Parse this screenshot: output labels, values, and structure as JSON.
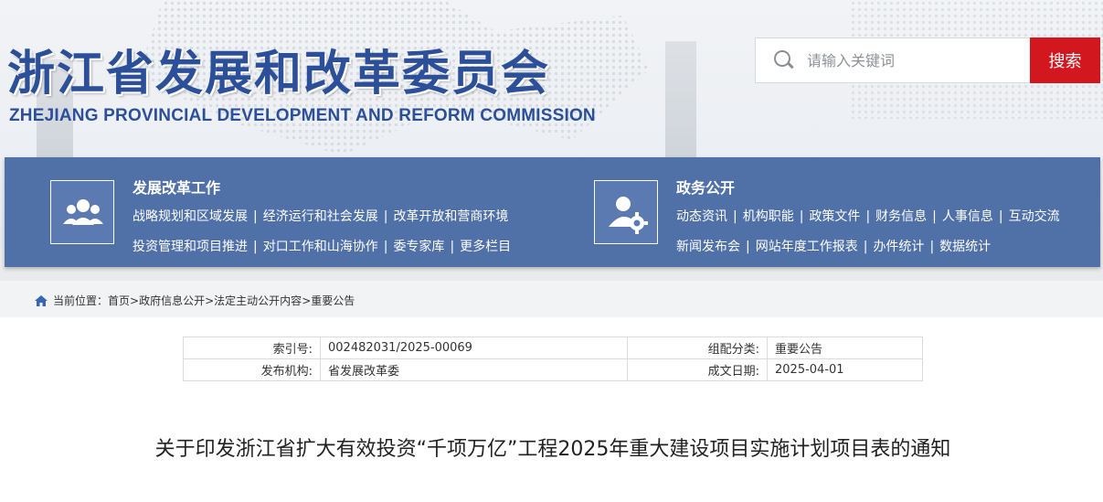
{
  "header": {
    "title_cn": "浙江省发展和改革委员会",
    "title_en": "ZHEJIANG PROVINCIAL DEVELOPMENT AND REFORM COMMISSION"
  },
  "search": {
    "placeholder": "请输入关键词",
    "button": "搜索"
  },
  "nav": {
    "groups": [
      {
        "icon": "people-group-icon",
        "heading": "发展改革工作",
        "row1": [
          "战略规划和区域发展",
          "经济运行和社会发展",
          "改革开放和营商环境"
        ],
        "row2": [
          "投资管理和项目推进",
          "对口工作和山海协作",
          "委专家库",
          "更多栏目"
        ]
      },
      {
        "icon": "user-settings-icon",
        "heading": "政务公开",
        "row1": [
          "动态资讯",
          "机构职能",
          "政策文件",
          "财务信息",
          "人事信息",
          "互动交流"
        ],
        "row2": [
          "新闻发布会",
          "网站年度工作报表",
          "办件统计",
          "数据统计"
        ]
      }
    ]
  },
  "breadcrumb": {
    "prefix": "当前位置：",
    "items": [
      "首页",
      "政府信息公开",
      "法定主动公开内容",
      "重要公告"
    ],
    "sep": ">"
  },
  "meta": {
    "index_label": "索引号:",
    "index_value": "002482031/2025-00069",
    "category_label": "组配分类:",
    "category_value": "重要公告",
    "publisher_label": "发布机构:",
    "publisher_value": "省发展改革委",
    "date_label": "成文日期:",
    "date_value": "2025-04-01"
  },
  "document": {
    "title": "关于印发浙江省扩大有效投资“千项万亿”工程2025年重大建设项目实施计划项目表的通知"
  },
  "colors": {
    "brand_blue": "#2c4f9a",
    "nav_blue": "#5070a8",
    "search_red": "#d2171e"
  }
}
